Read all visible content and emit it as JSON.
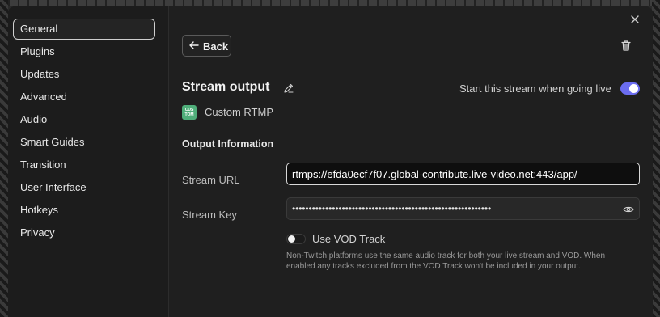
{
  "sidebar": {
    "items": [
      {
        "label": "General",
        "active": true
      },
      {
        "label": "Plugins"
      },
      {
        "label": "Updates"
      },
      {
        "label": "Advanced"
      },
      {
        "label": "Audio"
      },
      {
        "label": "Smart Guides"
      },
      {
        "label": "Transition"
      },
      {
        "label": "User Interface"
      },
      {
        "label": "Hotkeys"
      },
      {
        "label": "Privacy"
      }
    ]
  },
  "header": {
    "back_label": "Back",
    "icons": {
      "close": "close-icon",
      "back": "arrow-left-icon",
      "delete": "trash-icon"
    }
  },
  "stream": {
    "title": "Stream output",
    "provider_badge": "CUS TOM",
    "provider": "Custom RTMP",
    "go_live_label": "Start this stream when going live",
    "go_live_enabled": true,
    "toggle_color": "#6b6df0"
  },
  "output": {
    "section_title": "Output Information",
    "url_label": "Stream URL",
    "url_value": "rtmps://efda0ecf7f07.global-contribute.live-video.net:443/app/",
    "key_label": "Stream Key",
    "key_masked": "••••••••••••••••••••••••••••••••••••••••••••••••••••••••••••",
    "vod_label": "Use VOD Track",
    "vod_enabled": false,
    "vod_help": "Non-Twitch platforms use the same audio track for both your live stream and VOD. When enabled any tracks excluded from the VOD Track won't be included in your output."
  }
}
